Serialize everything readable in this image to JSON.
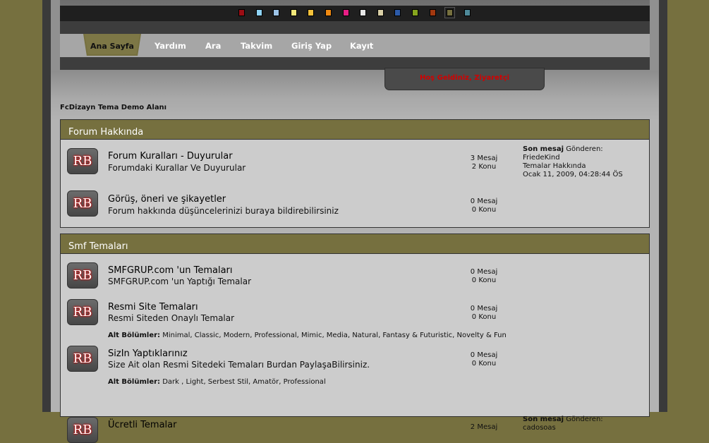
{
  "theme_swatches": [
    {
      "name": "red-theme",
      "color": "#9b0d14"
    },
    {
      "name": "light-blue-theme",
      "color": "#8fd3f4"
    },
    {
      "name": "blue-theme",
      "color": "#9cc3e6"
    },
    {
      "name": "yellow-theme",
      "color": "#f2e87a"
    },
    {
      "name": "gold-theme",
      "color": "#f5c23b"
    },
    {
      "name": "orange-theme",
      "color": "#f08a12"
    },
    {
      "name": "pink-theme",
      "color": "#e81e85"
    },
    {
      "name": "white-theme",
      "color": "#e6e6e6"
    },
    {
      "name": "beige-theme",
      "color": "#d9cfa6"
    },
    {
      "name": "navy-theme",
      "color": "#2c5aa8"
    },
    {
      "name": "green-theme",
      "color": "#86a51e"
    },
    {
      "name": "brown-theme",
      "color": "#a2380f"
    },
    {
      "name": "olive-theme",
      "color": "#76703f",
      "active": true
    },
    {
      "name": "teal-theme",
      "color": "#4f8a9a"
    }
  ],
  "nav": {
    "home": "Ana Sayfa",
    "help": "Yardım",
    "search": "Ara",
    "calendar": "Takvim",
    "login": "Giriş Yap",
    "register": "Kayıt"
  },
  "welcome": "Hoş Geldiniz, Ziyaretçi",
  "breadcrumb": "FcDizayn Tema Demo Alanı",
  "categories": [
    {
      "title": "Forum Hakkında",
      "boards": [
        {
          "icon": "RB",
          "title": "Forum Kuralları - Duyurular",
          "desc": "Forumdaki Kurallar Ve Duyurular",
          "posts": "3 Mesaj",
          "topics": "2 Konu",
          "last_label": "Son mesaj",
          "last_by": "Gönderen:",
          "last_user": "FriedeKind",
          "last_topic": "Temalar Hakkında",
          "last_date": "Ocak 11, 2009, 04:28:44 ÖS"
        },
        {
          "icon": "RB",
          "title": "Görüş, öneri ve şikayetler",
          "desc": "Forum hakkında düşüncelerinizi buraya bildirebilirsiniz",
          "posts": "0 Mesaj",
          "topics": "0 Konu"
        }
      ]
    },
    {
      "title": "Smf Temaları",
      "boards": [
        {
          "icon": "RB",
          "title": "SMFGRUP.com 'un Temaları",
          "desc": "SMFGRUP.com 'un Yaptığı Temalar",
          "posts": "0 Mesaj",
          "topics": "0 Konu"
        },
        {
          "icon": "RB",
          "title": "Resmi Site Temaları",
          "desc": "Resmi Siteden Onaylı Temalar",
          "posts": "0 Mesaj",
          "topics": "0 Konu",
          "sub_label": "Alt Bölümler:",
          "sub_list": "Minimal, Classic, Modern, Professional, Mimic, Media, Natural, Fantasy & Futuristic, Novelty & Fun"
        },
        {
          "icon": "RB",
          "title": "SizIn Yaptıklarınız",
          "desc": "Size Ait olan Resmi Sitedeki Temaları Burdan PaylaşaBilirsiniz.",
          "posts": "0 Mesaj",
          "topics": "0 Konu",
          "sub_label": "Alt Bölümler:",
          "sub_list": "Dark , Light, Serbest Stil, Amatör, Professional"
        },
        {
          "icon": "RB",
          "title": "Ücretli Temalar",
          "posts": "2 Mesaj",
          "last_label": "Son mesaj",
          "last_by": "Gönderen:",
          "last_user": "cadosoas"
        }
      ]
    }
  ]
}
